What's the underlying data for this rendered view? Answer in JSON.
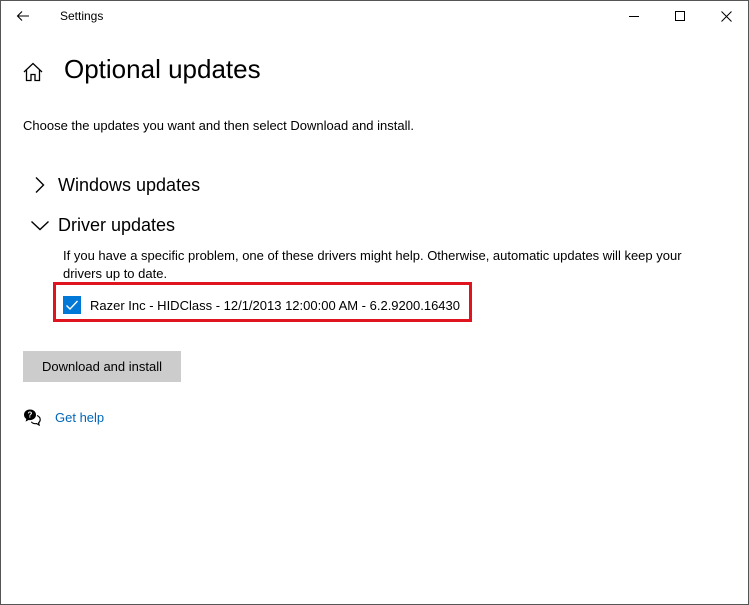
{
  "window": {
    "title": "Settings"
  },
  "page": {
    "title": "Optional updates",
    "intro": "Choose the updates you want and then select Download and install."
  },
  "sections": {
    "windows_updates": {
      "label": "Windows updates",
      "expanded": false
    },
    "driver_updates": {
      "label": "Driver updates",
      "expanded": true,
      "description": "If you have a specific problem, one of these drivers might help. Otherwise, automatic updates will keep your drivers up to date.",
      "items": [
        {
          "label": "Razer Inc - HIDClass - 12/1/2013 12:00:00 AM - 6.2.9200.16430",
          "checked": true
        }
      ]
    }
  },
  "actions": {
    "download_label": "Download and install"
  },
  "help": {
    "label": "Get help"
  },
  "colors": {
    "accent": "#0078d7",
    "link": "#0067b8",
    "highlight": "#e0141e",
    "button_bg": "#cccccc"
  },
  "icons": {
    "back": "back-arrow-icon",
    "minimize": "minimize-icon",
    "maximize": "maximize-icon",
    "close": "close-icon",
    "home": "home-icon",
    "collapsed": "chevron-right-icon",
    "expanded": "chevron-down-icon",
    "checkmark": "checkmark-icon",
    "help": "help-chat-icon"
  }
}
